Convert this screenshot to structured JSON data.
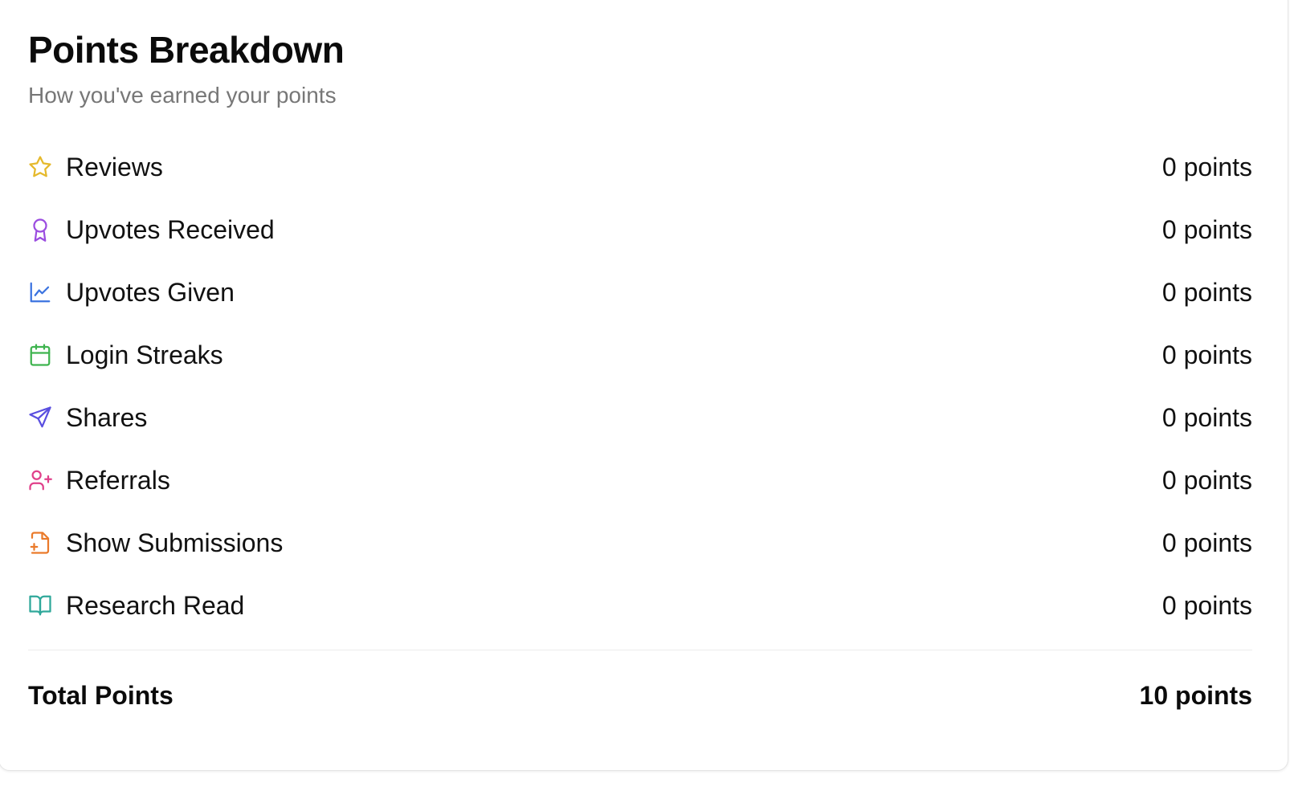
{
  "header": {
    "title": "Points Breakdown",
    "subtitle": "How you've earned your points"
  },
  "breakdown": {
    "items": [
      {
        "label": "Reviews",
        "value": "0 points",
        "icon": "star-icon",
        "color": "#e5b92c"
      },
      {
        "label": "Upvotes Received",
        "value": "0 points",
        "icon": "award-icon",
        "color": "#9b4de0"
      },
      {
        "label": "Upvotes Given",
        "value": "0 points",
        "icon": "line-chart-icon",
        "color": "#3b73e0"
      },
      {
        "label": "Login Streaks",
        "value": "0 points",
        "icon": "calendar-icon",
        "color": "#3fb44f"
      },
      {
        "label": "Shares",
        "value": "0 points",
        "icon": "send-icon",
        "color": "#5a4fe0"
      },
      {
        "label": "Referrals",
        "value": "0 points",
        "icon": "user-plus-icon",
        "color": "#e0408a"
      },
      {
        "label": "Show Submissions",
        "value": "0 points",
        "icon": "file-plus-icon",
        "color": "#ea7a2a"
      },
      {
        "label": "Research Read",
        "value": "0 points",
        "icon": "book-open-icon",
        "color": "#2fa89a"
      }
    ]
  },
  "total": {
    "label": "Total Points",
    "value": "10 points"
  }
}
